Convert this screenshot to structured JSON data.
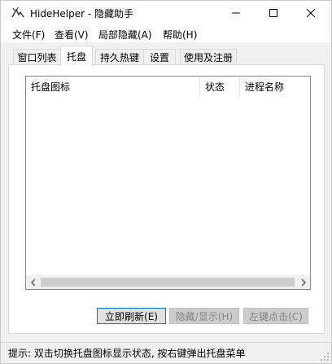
{
  "window": {
    "title": "HideHelper - 隐藏助手"
  },
  "menu": {
    "items": [
      {
        "label": "文件(F)"
      },
      {
        "label": "查看(V)"
      },
      {
        "label": "局部隐藏(A)"
      },
      {
        "label": "帮助(H)"
      }
    ]
  },
  "tabs": [
    {
      "label": "窗口列表",
      "active": false
    },
    {
      "label": "托盘",
      "active": true
    },
    {
      "label": "持久热键",
      "active": false
    },
    {
      "label": "设置",
      "active": false
    },
    {
      "label": "使用及注册",
      "active": false
    }
  ],
  "list": {
    "columns": [
      "托盘图标",
      "状态",
      "进程名称"
    ],
    "rows": []
  },
  "buttons": {
    "refresh": {
      "label": "立即刷新(E)",
      "enabled": true
    },
    "toggle": {
      "label": "隐藏/显示(H)",
      "enabled": false
    },
    "right_click": {
      "label": "左键点击(C)",
      "enabled": false
    }
  },
  "status": {
    "text": "提示: 双击切换托盘图标显示状态, 按右键弹出托盘菜单"
  },
  "colors": {
    "focus_border": "#0078d7",
    "window_bg": "#f0f0f0"
  }
}
